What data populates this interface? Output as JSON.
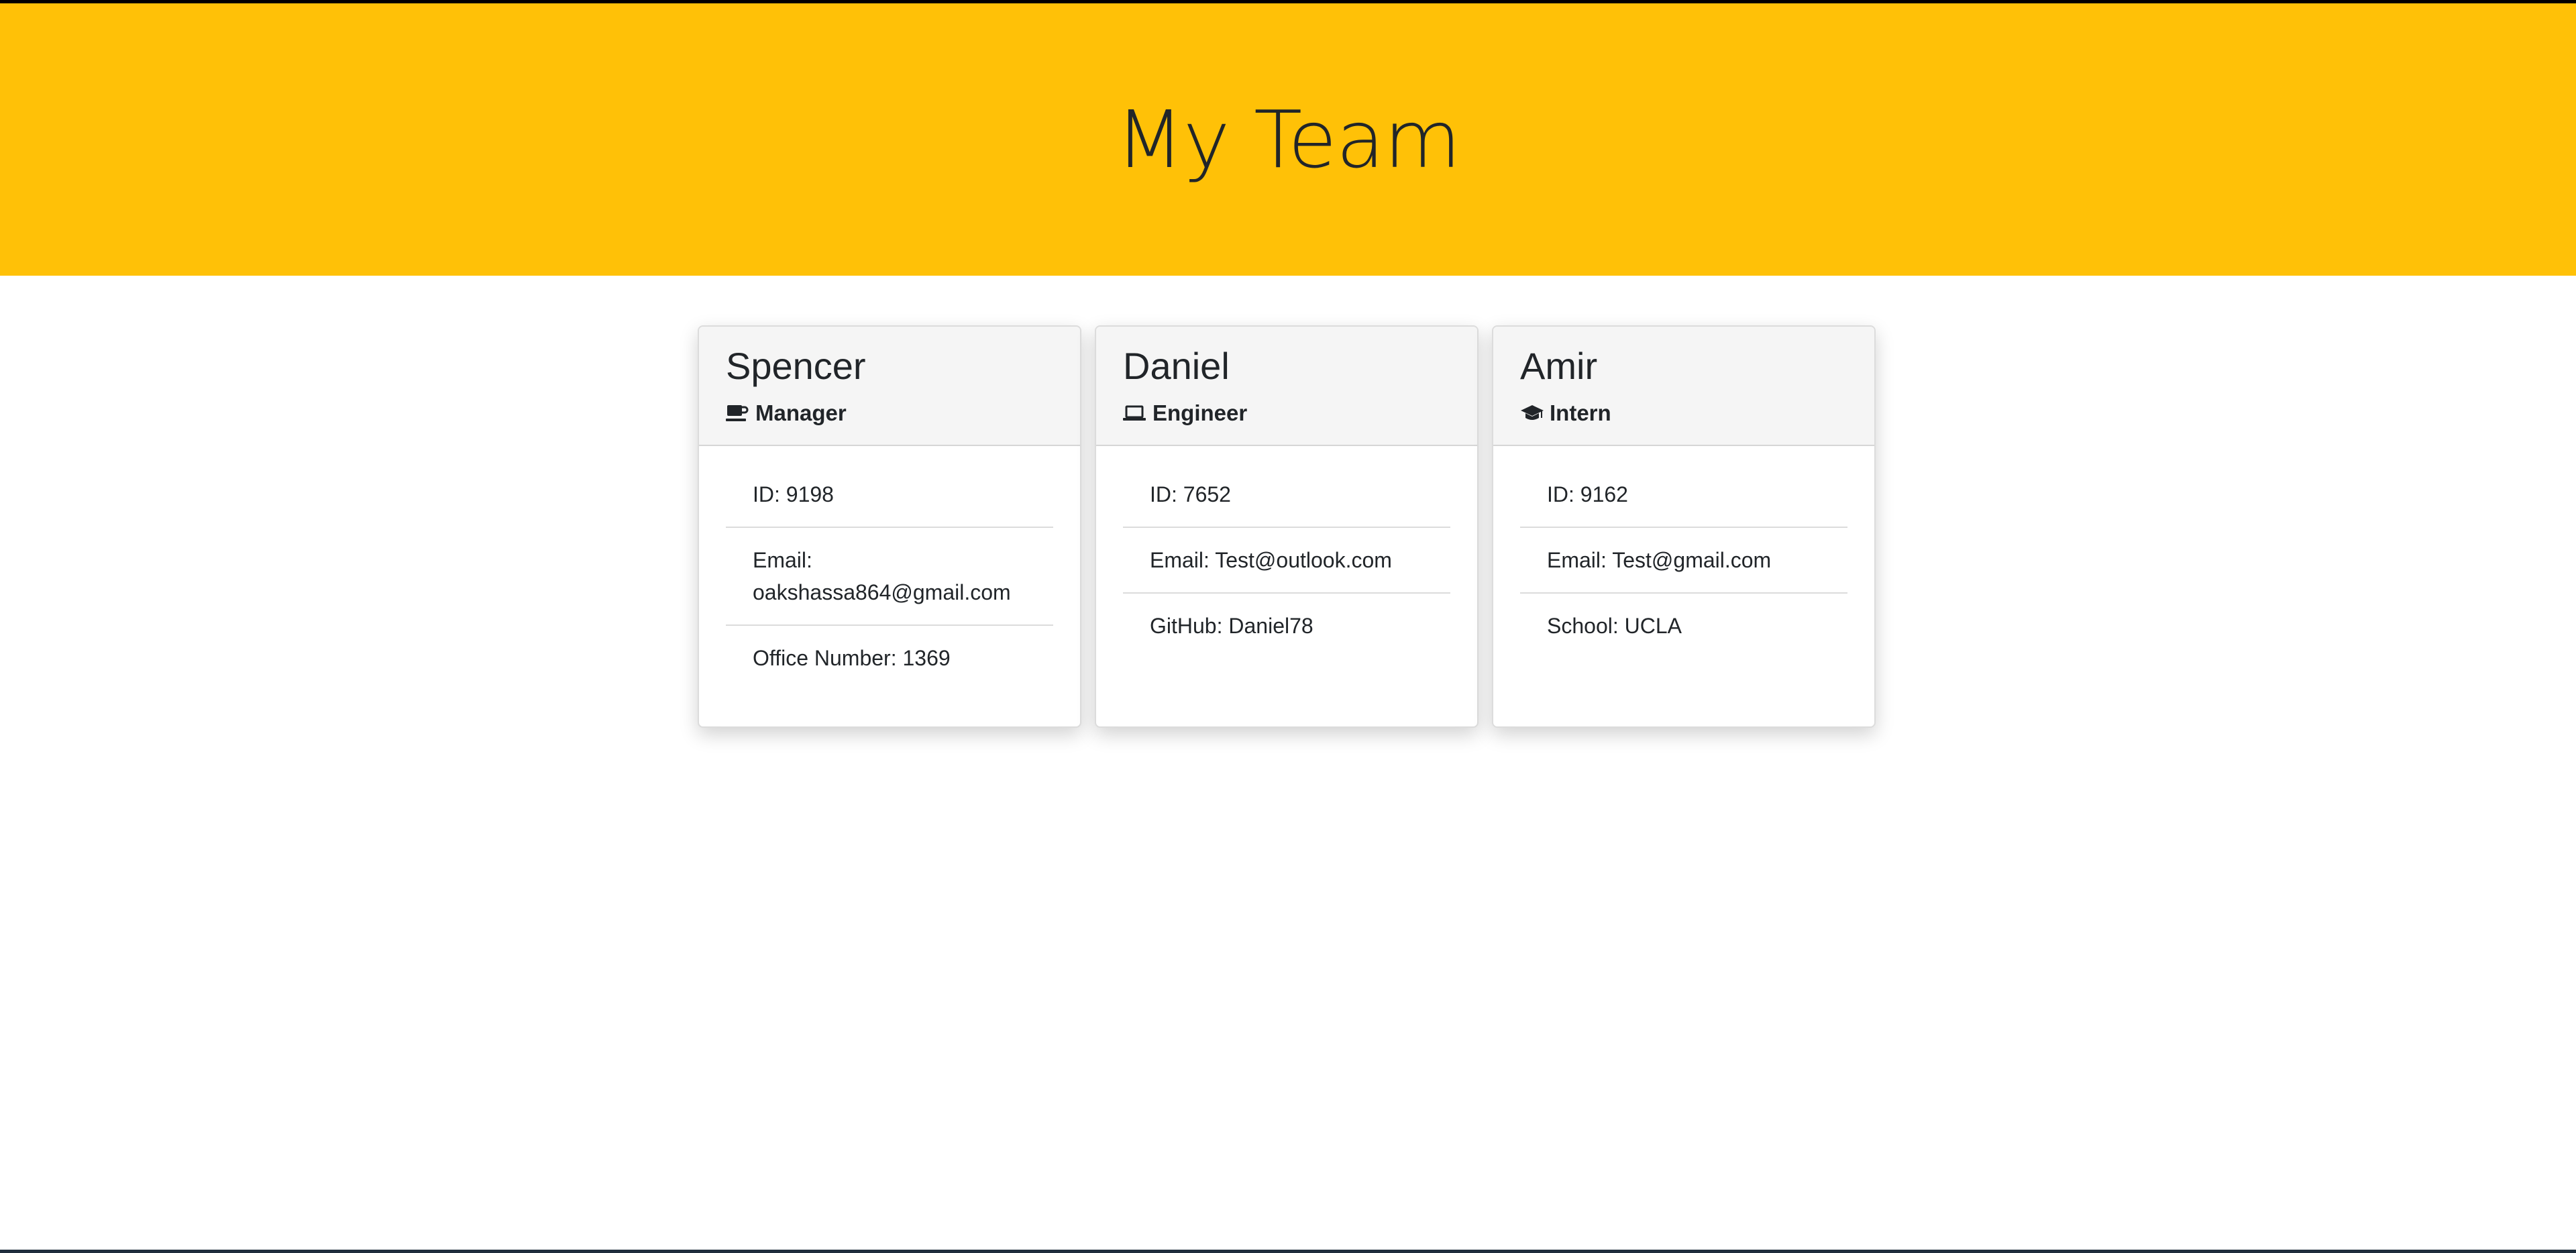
{
  "header": {
    "title": "My Team"
  },
  "colors": {
    "header_bg": "#ffc107",
    "card_header_bg": "#f5f5f5"
  },
  "team": [
    {
      "name": "Spencer",
      "role": "Manager",
      "icon": "coffee-mug-icon",
      "id_text": "ID: 9198",
      "email_text": "Email: oakshassa864@gmail.com",
      "extra_text": "Office Number: 1369"
    },
    {
      "name": "Daniel",
      "role": "Engineer",
      "icon": "laptop-icon",
      "id_text": "ID: 7652",
      "email_text": "Email: Test@outlook.com",
      "extra_text": "GitHub: Daniel78"
    },
    {
      "name": "Amir",
      "role": "Intern",
      "icon": "graduation-cap-icon",
      "id_text": "ID: 9162",
      "email_text": "Email: Test@gmail.com",
      "extra_text": "School: UCLA"
    }
  ]
}
